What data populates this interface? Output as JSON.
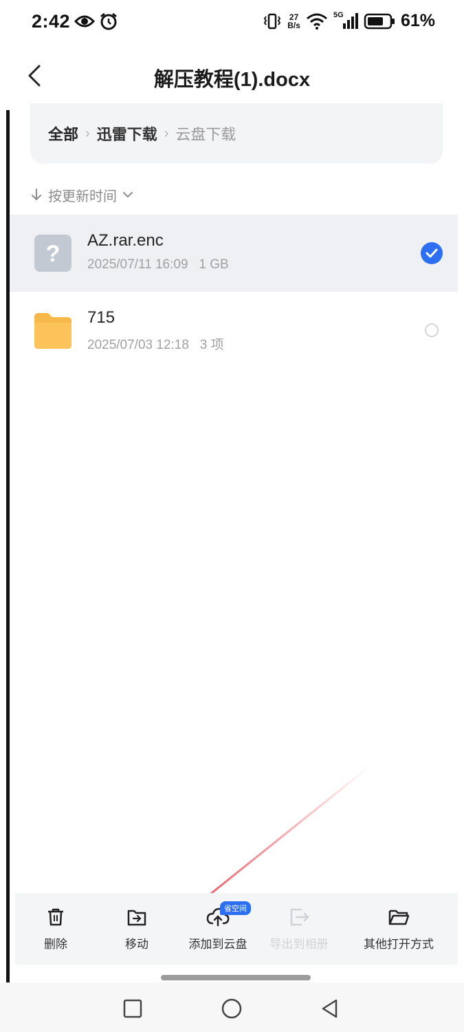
{
  "status_bar": {
    "time": "2:42",
    "net_speed_value": "27",
    "net_speed_unit": "B/s",
    "network": "5G",
    "battery": "61%"
  },
  "header": {
    "title": "解压教程(1).docx"
  },
  "breadcrumb": {
    "items": [
      "全部",
      "迅雷下载",
      "云盘下载"
    ]
  },
  "sort": {
    "label": "按更新时间"
  },
  "files": [
    {
      "name": "AZ.rar.enc",
      "date": "2025/07/11 16:09",
      "size": "1 GB",
      "selected": true
    },
    {
      "name": "715",
      "date": "2025/07/03 12:18",
      "size": "3 项",
      "selected": false
    }
  ],
  "actions": {
    "delete": "删除",
    "move": "移动",
    "add_to_cloud": "添加到云盘",
    "add_to_cloud_badge": "省空间",
    "export_album": "导出到相册",
    "open_with": "其他打开方式"
  },
  "colors": {
    "accent": "#2d6ff2",
    "folder": "#f7b84a",
    "arrow": "#e8434f"
  },
  "icons": {
    "back": "chevron-left-icon",
    "delete": "trash-icon",
    "move": "folder-move-icon",
    "cloud": "cloud-upload-icon",
    "export": "export-icon",
    "open_with": "folder-open-icon"
  }
}
